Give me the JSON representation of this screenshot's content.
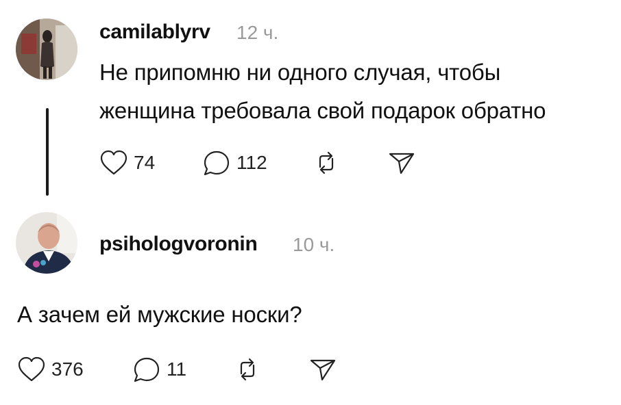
{
  "comments": [
    {
      "username": "camilablyrv",
      "time": "12 ч.",
      "text_lines": [
        "Не припомню ни одного случая, чтобы",
        "женщина требовала свой подарок обратно"
      ],
      "likes": "74",
      "replies": "112"
    },
    {
      "username": "psihologvoronin",
      "time": "10 ч.",
      "text_lines": [
        "А зачем ей мужские носки?"
      ],
      "likes": "376",
      "replies": "11"
    }
  ],
  "icons": {
    "like": "heart-icon",
    "reply": "comment-bubble-icon",
    "repost": "repost-icon",
    "share": "send-icon"
  }
}
